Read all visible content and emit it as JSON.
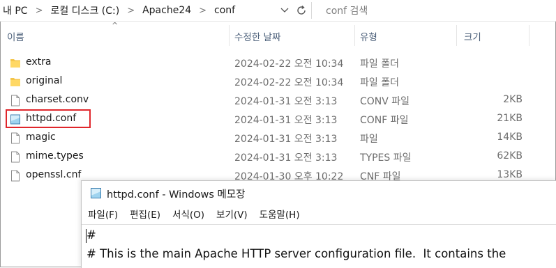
{
  "address_bar": {
    "crumbs": [
      "내 PC",
      "로컬 디스크 (C:)",
      "Apache24",
      "conf"
    ],
    "search_placeholder": "conf 검색"
  },
  "columns": {
    "name": "이름",
    "date": "수정한 날짜",
    "type": "유형",
    "size": "크기"
  },
  "files": [
    {
      "name": "extra",
      "date": "2024-02-22 오전 10:34",
      "type": "파일 폴더",
      "size": "",
      "icon": "folder-icon"
    },
    {
      "name": "original",
      "date": "2024-02-22 오전 10:34",
      "type": "파일 폴더",
      "size": "",
      "icon": "folder-icon"
    },
    {
      "name": "charset.conv",
      "date": "2024-01-31 오전 3:13",
      "type": "CONV 파일",
      "size": "2KB",
      "icon": "file-icon"
    },
    {
      "name": "httpd.conf",
      "date": "2024-01-31 오전 3:13",
      "type": "CONF 파일",
      "size": "21KB",
      "icon": "notepad-file-icon"
    },
    {
      "name": "magic",
      "date": "2024-01-31 오전 3:13",
      "type": "파일",
      "size": "14KB",
      "icon": "file-icon"
    },
    {
      "name": "mime.types",
      "date": "2024-01-31 오전 3:13",
      "type": "TYPES 파일",
      "size": "62KB",
      "icon": "file-icon"
    },
    {
      "name": "openssl.cnf",
      "date": "2024-01-30 오후 10:22",
      "type": "CNF 파일",
      "size": "13KB",
      "icon": "file-icon"
    }
  ],
  "highlight": {
    "color": "#e0262b",
    "target": "httpd.conf"
  },
  "notepad": {
    "title": "httpd.conf - Windows 메모장",
    "menu": [
      "파일(F)",
      "편집(E)",
      "서식(O)",
      "보기(V)",
      "도움말(H)"
    ],
    "lines": [
      "#",
      "# This is the main Apache HTTP server configuration file.  It contains the"
    ]
  }
}
